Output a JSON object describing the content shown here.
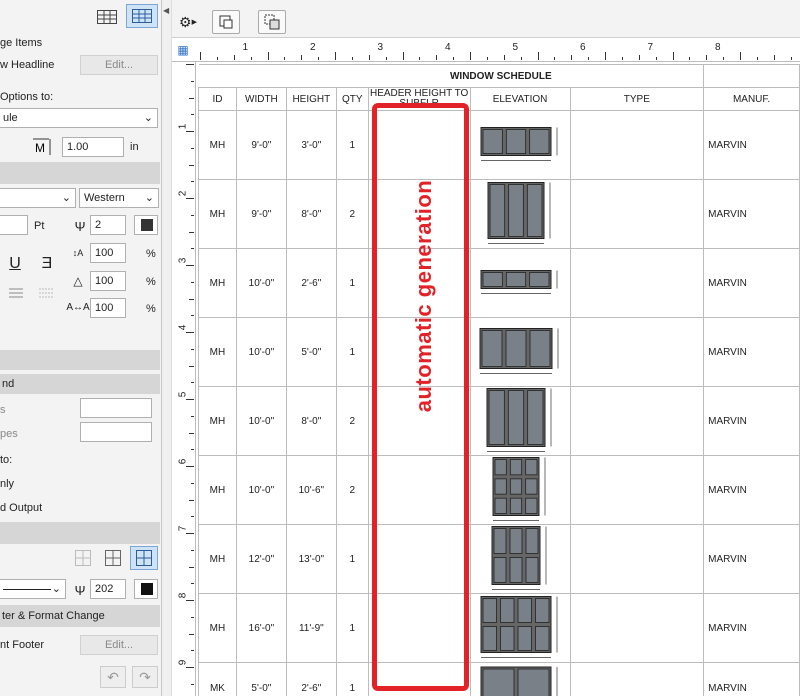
{
  "left_panel": {
    "items_label": "ge Items",
    "headline_label": "w Headline",
    "edit_btn": "Edit...",
    "options_label": "Options to:",
    "schedule_dropdown": "ule",
    "scale_value": "1.00",
    "scale_unit": "in",
    "font_dropdown": "",
    "script_dropdown": "Western",
    "pt_label": "Pt",
    "pen_value": "2",
    "pct1": "100",
    "pct2": "100",
    "pct3": "100",
    "pct_sym": "%",
    "nd_label": "nd",
    "s_label": "s",
    "pes_label": "pes",
    "to_label": "to:",
    "only_label": "nly",
    "output_label": "d Output",
    "line_pen_value": "202",
    "format_change_label": "ter & Format Change",
    "footer_label": "nt Footer",
    "footer_edit_btn": "Edit..."
  },
  "ruler": {
    "top_numbers": [
      "1",
      "2",
      "3",
      "4",
      "5",
      "6",
      "7",
      "8"
    ],
    "left_numbers": [
      "1",
      "2",
      "3",
      "4",
      "5",
      "6",
      "7",
      "8",
      "9"
    ]
  },
  "schedule": {
    "title": "WINDOW SCHEDULE",
    "headers": [
      "ID",
      "WIDTH",
      "HEIGHT",
      "QTY",
      "HEADER HEIGHT TO SUBFLR",
      "ELEVATION",
      "TYPE",
      "MANUF."
    ],
    "rows": [
      {
        "id": "MH",
        "width": "9'-0\"",
        "height": "3'-0\"",
        "qty": "1",
        "header": "-",
        "manuf": "MARVIN"
      },
      {
        "id": "MH",
        "width": "9'-0\"",
        "height": "8'-0\"",
        "qty": "2",
        "header": "-",
        "manuf": "MARVIN"
      },
      {
        "id": "MH",
        "width": "10'-0\"",
        "height": "2'-6\"",
        "qty": "1",
        "header": "-",
        "manuf": "MARVIN"
      },
      {
        "id": "MH",
        "width": "10'-0\"",
        "height": "5'-0\"",
        "qty": "1",
        "header": "-",
        "manuf": "MARVIN"
      },
      {
        "id": "MH",
        "width": "10'-0\"",
        "height": "8'-0\"",
        "qty": "2",
        "header": "-",
        "manuf": "MARVIN"
      },
      {
        "id": "MH",
        "width": "10'-0\"",
        "height": "10'-6\"",
        "qty": "2",
        "header": "-",
        "manuf": "MARVIN"
      },
      {
        "id": "MH",
        "width": "12'-0\"",
        "height": "13'-0\"",
        "qty": "1",
        "header": "-",
        "manuf": "MARVIN"
      },
      {
        "id": "MH",
        "width": "16'-0\"",
        "height": "11'-9\"",
        "qty": "1",
        "header": "-",
        "manuf": "MARVIN"
      },
      {
        "id": "MK",
        "width": "5'-0\"",
        "height": "2'-6\"",
        "qty": "1",
        "header": "-",
        "manuf": "MARVIN"
      }
    ]
  },
  "annotation": {
    "text": "automatic generation",
    "color": "#e32227"
  },
  "colors": {
    "accent": "#e32227",
    "selected_tab": "#cfe3f7"
  }
}
